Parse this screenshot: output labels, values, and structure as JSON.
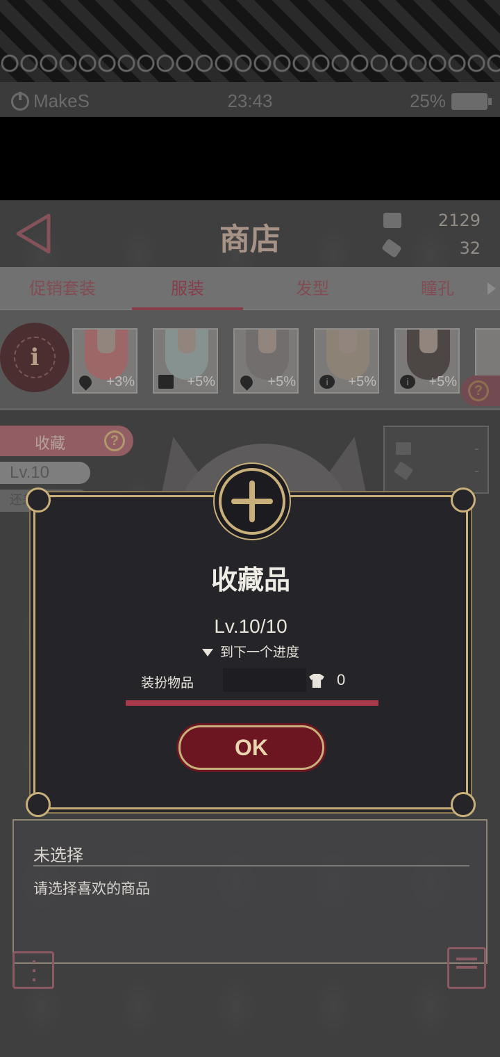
{
  "status_bar": {
    "brand": "MakeS",
    "time": "23:43",
    "battery": "25%"
  },
  "header": {
    "title": "商店",
    "currency_1": "2129",
    "currency_2": "32"
  },
  "tabs": [
    {
      "label": "促销套装",
      "active": false
    },
    {
      "label": "服装",
      "active": true
    },
    {
      "label": "发型",
      "active": false
    },
    {
      "label": "瞳孔",
      "active": false
    }
  ],
  "items": [
    {
      "icon": "heart-icon",
      "bonus": "+3%",
      "color": "#c97f7f"
    },
    {
      "icon": "book-icon",
      "bonus": "+5%",
      "color": "#a7b9b4"
    },
    {
      "icon": "heart-icon",
      "bonus": "+5%",
      "color": "#8f8888"
    },
    {
      "icon": "info-icon",
      "bonus": "+5%",
      "color": "#b1a493"
    },
    {
      "icon": "info-icon",
      "bonus": "+5%",
      "color": "#5b5352"
    }
  ],
  "info_button": "i",
  "side": {
    "collection_label": "收藏",
    "level": "Lv.10",
    "remaining": "还差"
  },
  "mini_panel": {
    "value_1": "-",
    "value_2": "-"
  },
  "dialog": {
    "title": "收藏品",
    "level": "Lv.10/10",
    "next_label": "到下一个进度",
    "progress_label": "装扮物品",
    "progress_count": "0",
    "progress_fraction": 1.0,
    "ok_label": "OK"
  },
  "description": {
    "title": "未选择",
    "text": "请选择喜欢的商品"
  },
  "colors": {
    "accent_gold": "#c9b07a",
    "accent_red": "#a8394a",
    "tab_text": "#a9485a"
  }
}
